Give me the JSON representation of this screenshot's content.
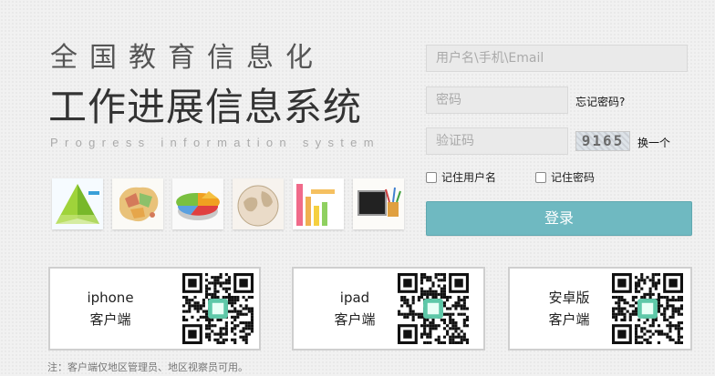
{
  "header": {
    "title_line1": "全国教育信息化",
    "title_line2": "工作进展信息系统",
    "subtitle_en": "Progress information system"
  },
  "thumbnails": [
    {
      "icon": "triangle-chart-icon"
    },
    {
      "icon": "china-map-icon"
    },
    {
      "icon": "pie-chart-icon"
    },
    {
      "icon": "globe-icon"
    },
    {
      "icon": "bar-chart-icon"
    },
    {
      "icon": "blackboard-icon"
    }
  ],
  "login": {
    "username_placeholder": "用户名\\手机\\Email",
    "password_placeholder": "密码",
    "forgot_password": "忘记密码?",
    "captcha_placeholder": "验证码",
    "captcha_text": "9165",
    "refresh_captcha": "换一个",
    "remember_username": "记住用户名",
    "remember_password": "记住密码",
    "submit": "登录"
  },
  "clients": [
    {
      "line1": "iphone",
      "line2": "客户端"
    },
    {
      "line1": "ipad",
      "line2": "客户端"
    },
    {
      "line1": "安卓版",
      "line2": "客户端"
    }
  ],
  "note": "注：客户端仅地区管理员、地区视察员可用。",
  "colors": {
    "login_button": "#6fb9c1",
    "qr_center": "#5ec8a8"
  }
}
